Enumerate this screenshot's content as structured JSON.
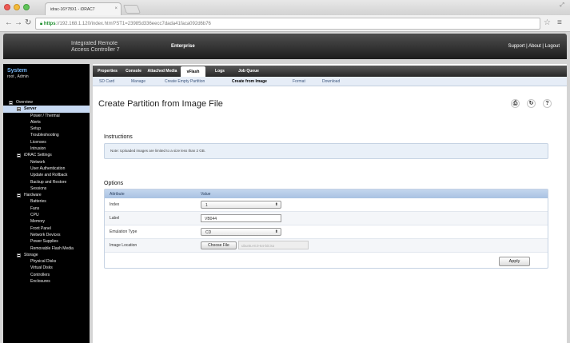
{
  "browser": {
    "tab_title": "idrac-16Y78X1 - iDRAC7",
    "tab_close": "×",
    "url_scheme": "https",
    "url_rest": "://192.168.1.120/index.html?ST1=23985d336eecc7dada41faca092d6b76",
    "icons": [
      "back-icon",
      "forward-icon",
      "reload-icon",
      "lock-icon",
      "star-icon",
      "menu-icon"
    ]
  },
  "header": {
    "brand_line1": "Integrated Remote",
    "brand_line2": "Access Controller 7",
    "edition": "Enterprise",
    "links": "Support | About | Logout"
  },
  "system": {
    "title": "System",
    "user": "root , Admin"
  },
  "tree": [
    {
      "label": "Overview",
      "level": 0,
      "expander": true
    },
    {
      "label": "Server",
      "level": 1,
      "expander": true,
      "selected": true
    },
    {
      "label": "Power / Thermal",
      "level": 2
    },
    {
      "label": "Alerts",
      "level": 2
    },
    {
      "label": "Setup",
      "level": 2
    },
    {
      "label": "Troubleshooting",
      "level": 2
    },
    {
      "label": "Licenses",
      "level": 2
    },
    {
      "label": "Intrusion",
      "level": 2
    },
    {
      "label": "iDRAC Settings",
      "level": 1,
      "expander": true
    },
    {
      "label": "Network",
      "level": 2
    },
    {
      "label": "User Authentication",
      "level": 2
    },
    {
      "label": "Update and Rollback",
      "level": 2
    },
    {
      "label": "Backup and Restore",
      "level": 2
    },
    {
      "label": "Sessions",
      "level": 2
    },
    {
      "label": "Hardware",
      "level": 1,
      "expander": true
    },
    {
      "label": "Batteries",
      "level": 2
    },
    {
      "label": "Fans",
      "level": 2
    },
    {
      "label": "CPU",
      "level": 2
    },
    {
      "label": "Memory",
      "level": 2
    },
    {
      "label": "Front Panel",
      "level": 2
    },
    {
      "label": "Network Devices",
      "level": 2
    },
    {
      "label": "Power Supplies",
      "level": 2
    },
    {
      "label": "Removable Flash Media",
      "level": 2
    },
    {
      "label": "Storage",
      "level": 1,
      "expander": true
    },
    {
      "label": "Physical Disks",
      "level": 2
    },
    {
      "label": "Virtual Disks",
      "level": 2
    },
    {
      "label": "Controllers",
      "level": 2
    },
    {
      "label": "Enclosures",
      "level": 2
    }
  ],
  "main_tabs": [
    "Properties",
    "Console",
    "Attached Media",
    "vFlash",
    "Logs",
    "Job Queue"
  ],
  "active_main_tab": "vFlash",
  "sub_tabs": [
    "SD Card",
    "Manage",
    "Create Empty Partition",
    "Create from Image",
    "Format",
    "Download"
  ],
  "active_sub_tab": "Create from Image",
  "page": {
    "title": "Create Partition from Image File",
    "icons": [
      "print-icon",
      "refresh-icon",
      "help-icon"
    ]
  },
  "instructions": {
    "heading": "Instructions",
    "note": "Note: Uploaded images are limited to a size less than 2 GB."
  },
  "options": {
    "heading": "Options",
    "col_attribute": "Attribute",
    "col_value": "Value",
    "index_label": "Index",
    "index_value": "1",
    "label_label": "Label",
    "label_value": "VB044",
    "emulation_label": "Emulation Type",
    "emulation_value": "CD",
    "image_label": "Image Location",
    "choose_file": "Choose File",
    "file_name": "ubuntu-8.0-64-bit.iso",
    "apply": "Apply"
  }
}
